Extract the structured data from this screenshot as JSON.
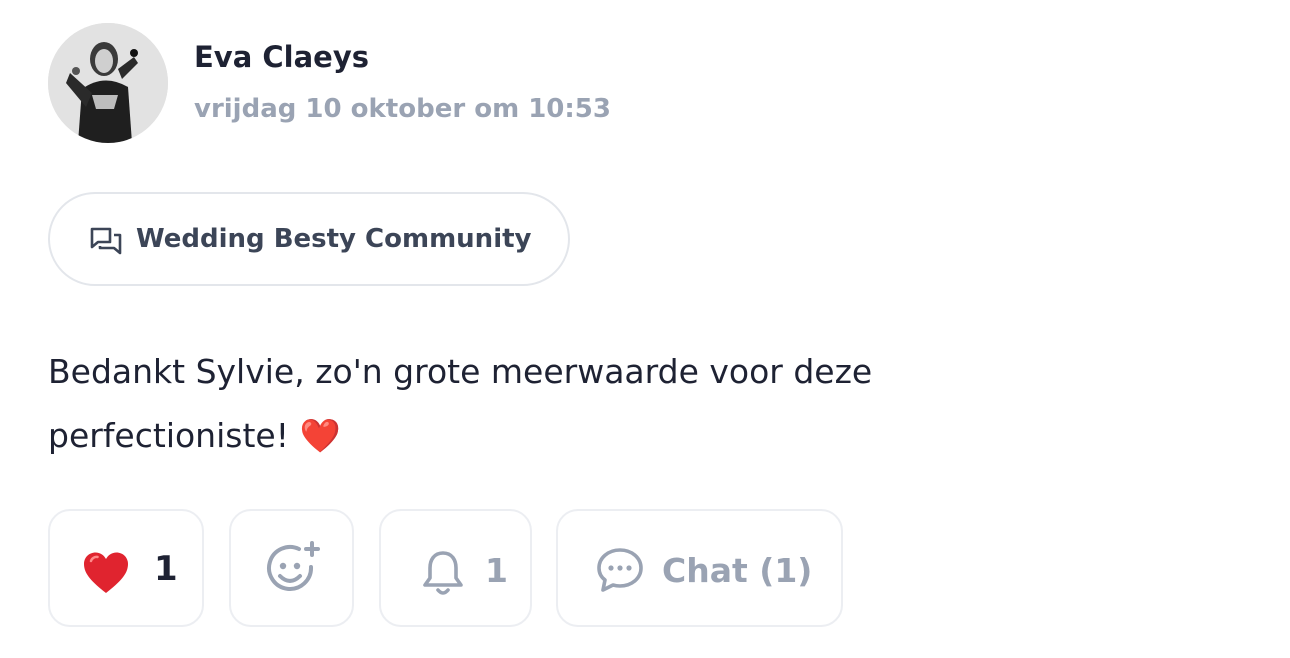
{
  "post": {
    "author": {
      "name": "Eva Claeys",
      "avatar_icon": "avatar-photo"
    },
    "timestamp": "vrijdag 10 oktober om 10:53",
    "community": {
      "icon": "chat-bubbles-icon",
      "label": "Wedding Besty Community"
    },
    "message": {
      "line1": "Bedankt Sylvie, zo'n grote meerwaarde voor deze",
      "line2": "perfectioniste!",
      "emoji": "❤️"
    }
  },
  "actions": {
    "reaction": {
      "icon": "heart-icon",
      "count": "1"
    },
    "add_reaction": {
      "icon": "smiley-plus-icon"
    },
    "follow": {
      "icon": "bell-icon",
      "count": "1"
    },
    "chat": {
      "icon": "chat-bubble-icon",
      "label": "Chat (1)"
    }
  },
  "colors": {
    "text_primary": "#1e2233",
    "text_muted": "#9aa3b3",
    "border": "#e3e6eb",
    "heart": "#e0242f"
  }
}
